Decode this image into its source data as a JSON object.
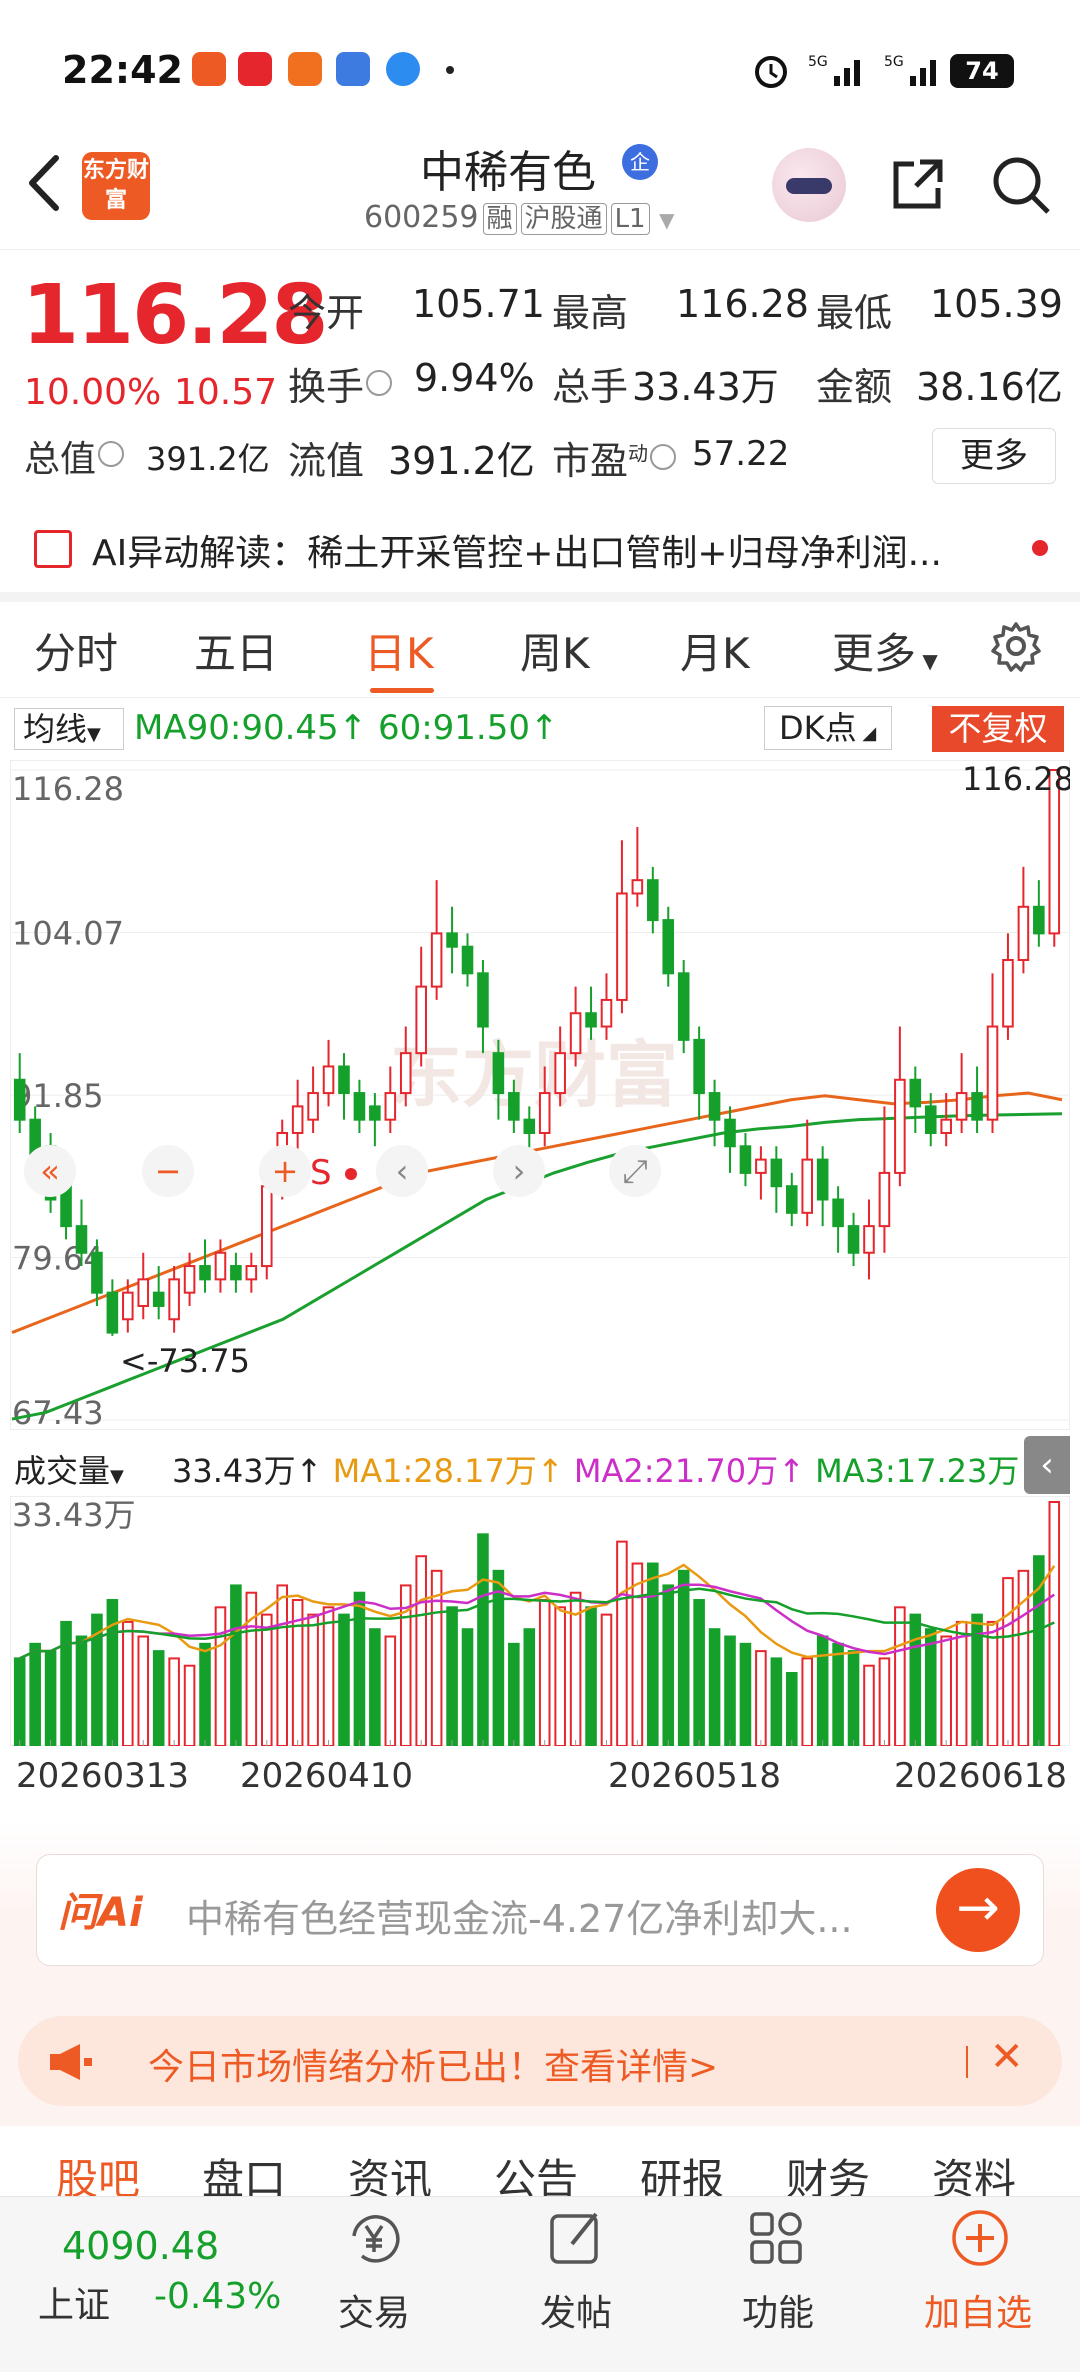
{
  "status_bar": {
    "time": "22:42",
    "battery": "74",
    "network": "5G"
  },
  "header": {
    "back_icon": "chevron-left-icon",
    "logo_text": "东方财富",
    "stock_name": "中稀有色",
    "badge": "企",
    "code": "600259",
    "tags": [
      "融",
      "沪股通",
      "L1"
    ]
  },
  "quote": {
    "price": "116.28",
    "change_pct": "10.00%",
    "change": "10.57",
    "open_label": "今开",
    "open": "105.71",
    "high_label": "最高",
    "high": "116.28",
    "low_label": "最低",
    "low": "105.39",
    "turnover_label": "换手",
    "turnover": "9.94%",
    "volume_label": "总手",
    "volume": "33.43万",
    "amount_label": "金额",
    "amount": "38.16亿",
    "mktcap_label": "总值",
    "mktcap": "391.2亿",
    "float_label": "流值",
    "float_cap": "391.2亿",
    "pe_label": "市盈",
    "pe_sup": "动",
    "pe": "57.22",
    "more_label": "更多"
  },
  "ai_strip": {
    "text": "AI异动解读：稀土开采管控+出口管制+归母净利润..."
  },
  "tabs": {
    "items": [
      "分时",
      "五日",
      "日K",
      "周K",
      "月K",
      "更多"
    ],
    "active": "日K"
  },
  "chart_bar": {
    "ma_select": "均线",
    "ma_info": "MA90:90.45↑ 60:91.50↑",
    "dk": "DK点",
    "fq": "不复权"
  },
  "chart_data": {
    "type": "candlestick",
    "y_ticks": [
      "116.28",
      "104.07",
      "91.85",
      "79.64",
      "67.43"
    ],
    "ylim": [
      67.43,
      116.28
    ],
    "max_label": "116.28->",
    "min_label": "<-73.75",
    "candles": [
      [
        93,
        90,
        95,
        89
      ],
      [
        90,
        87,
        91,
        85
      ],
      [
        88,
        84,
        89,
        83
      ],
      [
        85,
        82,
        86,
        81
      ],
      [
        82,
        80,
        84,
        79
      ],
      [
        80,
        77,
        81,
        76
      ],
      [
        77,
        74,
        78,
        73.75
      ],
      [
        75,
        77,
        78,
        74
      ],
      [
        76,
        78,
        80,
        75
      ],
      [
        77,
        76,
        79,
        75
      ],
      [
        75,
        78,
        79,
        74
      ],
      [
        77,
        79,
        80,
        76
      ],
      [
        79,
        78,
        81,
        77
      ],
      [
        78,
        80,
        81,
        77
      ],
      [
        79,
        78,
        80,
        77
      ],
      [
        78,
        79,
        80,
        77
      ],
      [
        79,
        85,
        86,
        78
      ],
      [
        85,
        89,
        90,
        84
      ],
      [
        89,
        91,
        93,
        87
      ],
      [
        90,
        92,
        94,
        89
      ],
      [
        92,
        94,
        96,
        91
      ],
      [
        94,
        92,
        95,
        90
      ],
      [
        92,
        90,
        93,
        89
      ],
      [
        91,
        90,
        92,
        88
      ],
      [
        90,
        92,
        94,
        89
      ],
      [
        92,
        95,
        97,
        91
      ],
      [
        95,
        100,
        103,
        94
      ],
      [
        100,
        104,
        108,
        99
      ],
      [
        104,
        103,
        106,
        101
      ],
      [
        103,
        101,
        104,
        100
      ],
      [
        101,
        97,
        102,
        95
      ],
      [
        95,
        92,
        96,
        90
      ],
      [
        92,
        90,
        93,
        89
      ],
      [
        90,
        89,
        91,
        87
      ],
      [
        89,
        92,
        94,
        88
      ],
      [
        92,
        95,
        97,
        91
      ],
      [
        95,
        98,
        100,
        94
      ],
      [
        98,
        97,
        100,
        96
      ],
      [
        97,
        99,
        101,
        96
      ],
      [
        99,
        107,
        111,
        98
      ],
      [
        107,
        108,
        112,
        106
      ],
      [
        108,
        105,
        109,
        104
      ],
      [
        105,
        101,
        106,
        100
      ],
      [
        101,
        96,
        102,
        95
      ],
      [
        96,
        92,
        97,
        90
      ],
      [
        92,
        90,
        93,
        88
      ],
      [
        90,
        88,
        91,
        86
      ],
      [
        88,
        86,
        89,
        85
      ],
      [
        86,
        87,
        88,
        84
      ],
      [
        87,
        85,
        88,
        83
      ],
      [
        85,
        83,
        86,
        82
      ],
      [
        83,
        87,
        90,
        82
      ],
      [
        87,
        84,
        88,
        82
      ],
      [
        84,
        82,
        85,
        80
      ],
      [
        82,
        80,
        83,
        79
      ],
      [
        80,
        82,
        84,
        78
      ],
      [
        82,
        86,
        91,
        80
      ],
      [
        86,
        93,
        97,
        85
      ],
      [
        93,
        91,
        94,
        89
      ],
      [
        91,
        89,
        92,
        88
      ],
      [
        89,
        90,
        92,
        88
      ],
      [
        90,
        92,
        95,
        89
      ],
      [
        92,
        90,
        94,
        89
      ],
      [
        90,
        97,
        101,
        89
      ],
      [
        97,
        102,
        104,
        96
      ],
      [
        102,
        106,
        109,
        101
      ],
      [
        106,
        104,
        108,
        103
      ],
      [
        104,
        116.28,
        116.28,
        103
      ]
    ],
    "ma_series": [
      {
        "name": "60",
        "values": [
          74,
          75,
          76,
          77,
          78,
          79,
          80,
          81,
          82,
          83,
          84,
          85,
          86,
          86.5,
          87,
          87.5,
          88,
          88.5,
          89,
          89.5,
          90,
          90.5,
          91,
          91.5,
          91.8,
          91.5,
          91.2,
          91.3,
          91.5,
          91.8,
          92.0,
          91.5
        ]
      },
      {
        "name": "MA90",
        "values": [
          67.5,
          68,
          69,
          70,
          71,
          72,
          73,
          74,
          75,
          76.5,
          78,
          79.5,
          81,
          82.5,
          84,
          85,
          86,
          86.8,
          87.5,
          88,
          88.5,
          89,
          89.3,
          89.5,
          89.8,
          90,
          90.1,
          90.2,
          90.3,
          90.35,
          90.4,
          90.45
        ]
      }
    ],
    "volume": {
      "label": "成交量",
      "value": "33.43万",
      "max_label": "33.43万",
      "ma_info": [
        {
          "name": "MA1",
          "text": "MA1:28.17万↑",
          "color": "#e89a12"
        },
        {
          "name": "MA2",
          "text": "MA2:21.70万↑",
          "color": "#cc2fc8"
        },
        {
          "name": "MA3",
          "text": "MA3:17.23万↑",
          "color": "#14a02a"
        }
      ],
      "values": [
        12,
        14,
        13,
        17,
        15,
        18,
        20,
        17,
        15,
        13,
        12,
        11,
        14,
        19,
        22,
        21,
        18,
        22,
        20,
        18,
        19,
        18,
        21,
        16,
        15,
        22,
        26,
        24,
        19,
        16,
        29,
        24,
        14,
        16,
        20,
        19,
        21,
        19,
        18,
        28,
        25,
        25,
        22,
        24,
        20,
        16,
        15,
        14,
        13,
        12,
        10,
        12,
        15,
        14,
        13,
        11,
        12,
        19,
        18,
        16,
        15,
        17,
        18,
        17,
        23,
        24,
        26,
        33.43
      ]
    },
    "x_ticks": [
      "20260313",
      "20260410",
      "20260518",
      "20260618"
    ]
  },
  "ask_ai": {
    "logo": "问Ai",
    "text": "中稀有色经营现金流-4.27亿净利却大..."
  },
  "sentiment": {
    "text": "今日市场情绪分析已出！查看详情>"
  },
  "section_tabs": [
    "股吧",
    "盘口",
    "资讯",
    "公告",
    "研报",
    "财务",
    "资料"
  ],
  "bottom_nav": {
    "index_value": "4090.48",
    "index_name": "上证",
    "index_change": "-0.43%",
    "items": [
      {
        "label": "交易",
        "icon": "yen-icon"
      },
      {
        "label": "发帖",
        "icon": "edit-icon"
      },
      {
        "label": "功能",
        "icon": "grid-icon"
      },
      {
        "label": "加自选",
        "icon": "plus-circle-icon"
      }
    ]
  },
  "colors": {
    "up": "#e6262d",
    "down": "#14a02a",
    "accent": "#ee5a24"
  }
}
